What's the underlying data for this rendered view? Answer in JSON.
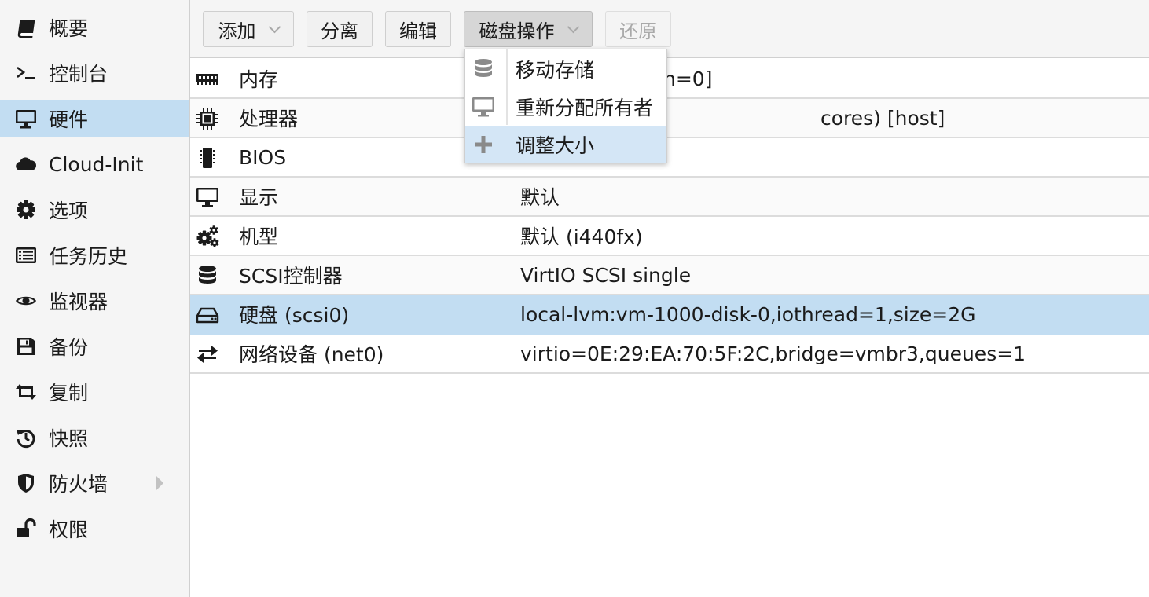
{
  "sidebar": {
    "items": [
      {
        "label": "概要",
        "icon": "book-icon"
      },
      {
        "label": "控制台",
        "icon": "terminal-icon"
      },
      {
        "label": "硬件",
        "icon": "desktop-icon"
      },
      {
        "label": "Cloud-Init",
        "icon": "cloud-icon"
      },
      {
        "label": "选项",
        "icon": "gear-icon"
      },
      {
        "label": "任务历史",
        "icon": "list-icon"
      },
      {
        "label": "监视器",
        "icon": "eye-icon"
      },
      {
        "label": "备份",
        "icon": "floppy-icon"
      },
      {
        "label": "复制",
        "icon": "retweet-icon"
      },
      {
        "label": "快照",
        "icon": "history-icon"
      },
      {
        "label": "防火墙",
        "icon": "shield-icon"
      },
      {
        "label": "权限",
        "icon": "unlock-icon"
      }
    ],
    "active": "硬件"
  },
  "toolbar": {
    "add_label": "添加",
    "detach_label": "分离",
    "edit_label": "编辑",
    "disk_action_label": "磁盘操作",
    "revert_label": "还原"
  },
  "grid": {
    "rows": [
      {
        "name": "内存",
        "value": "",
        "icon": "memory-icon"
      },
      {
        "name": "处理器",
        "value": "",
        "icon": "cpu-icon"
      },
      {
        "name": "BIOS",
        "value": "",
        "icon": "microchip-icon"
      },
      {
        "name": "显示",
        "value": "默认",
        "icon": "desktop-icon"
      },
      {
        "name": "机型",
        "value": "默认 (i440fx)",
        "icon": "cogs-icon"
      },
      {
        "name": "SCSI控制器",
        "value": "VirtIO SCSI single",
        "icon": "database-icon"
      },
      {
        "name": "硬盘 (scsi0)",
        "value": "local-lvm:vm-1000-disk-0,iothread=1,size=2G",
        "icon": "hdd-icon"
      },
      {
        "name": "网络设备 (net0)",
        "value": "virtio=0E:29:EA:70:5F:2C,bridge=vmbr3,queues=1",
        "icon": "exchange-icon"
      }
    ],
    "partial_values": {
      "memory_tail": "n=0]",
      "cpu_tail": "cores) [host]"
    }
  },
  "disk_menu": {
    "items": [
      {
        "label": "移动存储",
        "icon": "database-icon"
      },
      {
        "label": "重新分配所有者",
        "icon": "desktop-icon"
      },
      {
        "label": "调整大小",
        "icon": "plus-icon"
      }
    ],
    "hovered": "调整大小"
  },
  "colors": {
    "selection": "#c2ddf2",
    "menu_hover": "#d4e6f6",
    "sidebar_bg": "#f5f5f5",
    "icon": "#1b1b1b",
    "menu_icon": "#8a8a8a"
  }
}
